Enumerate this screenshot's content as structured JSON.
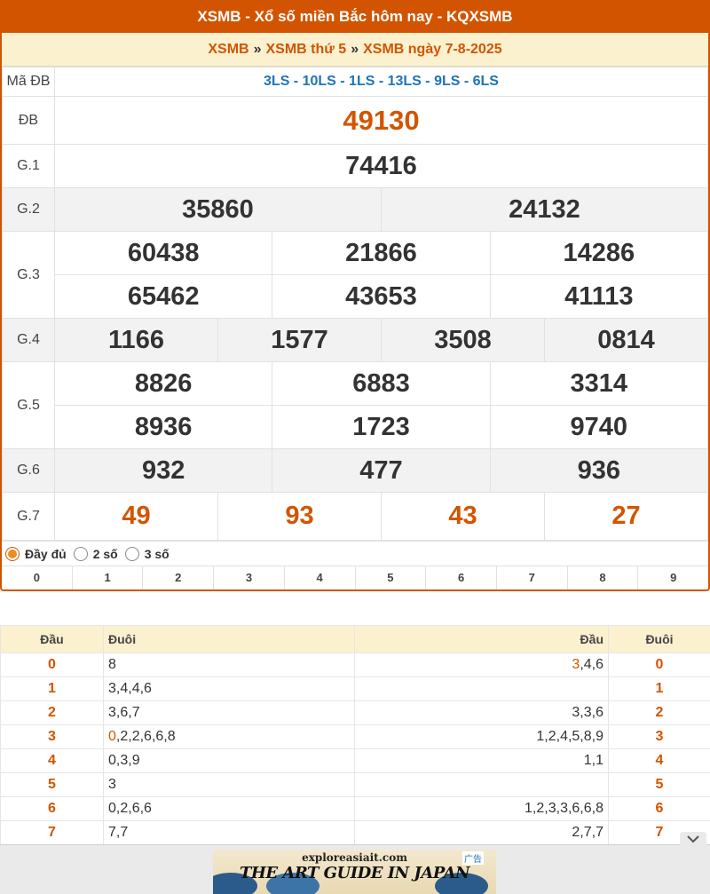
{
  "header": {
    "title": "XSMB - Xổ số miền Bắc hôm nay - KQXSMB",
    "breadcrumb": [
      "XSMB",
      "XSMB thứ 5",
      "XSMB ngày 7-8-2025"
    ],
    "sep": "»"
  },
  "results": {
    "code_label": "Mã ĐB",
    "code_value": "3LS - 10LS - 1LS - 13LS - 9LS - 6LS",
    "db_label": "ĐB",
    "db": "49130",
    "g1_label": "G.1",
    "g1": "74416",
    "g2_label": "G.2",
    "g2": [
      "35860",
      "24132"
    ],
    "g3_label": "G.3",
    "g3": [
      "60438",
      "21866",
      "14286",
      "65462",
      "43653",
      "41113"
    ],
    "g4_label": "G.4",
    "g4": [
      "1166",
      "1577",
      "3508",
      "0814"
    ],
    "g5_label": "G.5",
    "g5": [
      "8826",
      "6883",
      "3314",
      "8936",
      "1723",
      "9740"
    ],
    "g6_label": "G.6",
    "g6": [
      "932",
      "477",
      "936"
    ],
    "g7_label": "G.7",
    "g7": [
      "49",
      "93",
      "43",
      "27"
    ]
  },
  "options": [
    "Đầy đủ",
    "2 số",
    "3 số"
  ],
  "digits": [
    "0",
    "1",
    "2",
    "3",
    "4",
    "5",
    "6",
    "7",
    "8",
    "9"
  ],
  "loto": {
    "headers": [
      "Đầu",
      "Đuôi",
      "Đầu",
      "Đuôi"
    ],
    "rows": [
      {
        "d": "0",
        "left_hl": "",
        "left": "8",
        "right_hl": "3",
        "right": ",4,6"
      },
      {
        "d": "1",
        "left_hl": "",
        "left": "3,4,4,6",
        "right_hl": "",
        "right": ""
      },
      {
        "d": "2",
        "left_hl": "",
        "left": "3,6,7",
        "right_hl": "",
        "right": "3,3,6"
      },
      {
        "d": "3",
        "left_hl": "0",
        "left": ",2,2,6,6,8",
        "right_hl": "",
        "right": "1,2,4,5,8,9"
      },
      {
        "d": "4",
        "left_hl": "",
        "left": "0,3,9",
        "right_hl": "",
        "right": "1,1"
      },
      {
        "d": "5",
        "left_hl": "",
        "left": "3",
        "right_hl": "",
        "right": ""
      },
      {
        "d": "6",
        "left_hl": "",
        "left": "0,2,6,6",
        "right_hl": "",
        "right": "1,2,3,3,6,6,8"
      },
      {
        "d": "7",
        "left_hl": "",
        "left": "7,7",
        "right_hl": "",
        "right": "2,7,7"
      }
    ]
  },
  "ad": {
    "site": "exploreasiait.com",
    "headline": "THE ART GUIDE IN JAPAN",
    "tag": "广告",
    "collapse_icon": "chevron-down-icon"
  },
  "colors": {
    "accent": "#d35400",
    "code_blue": "#1e73be",
    "header_bg": "#fbf1cf"
  }
}
